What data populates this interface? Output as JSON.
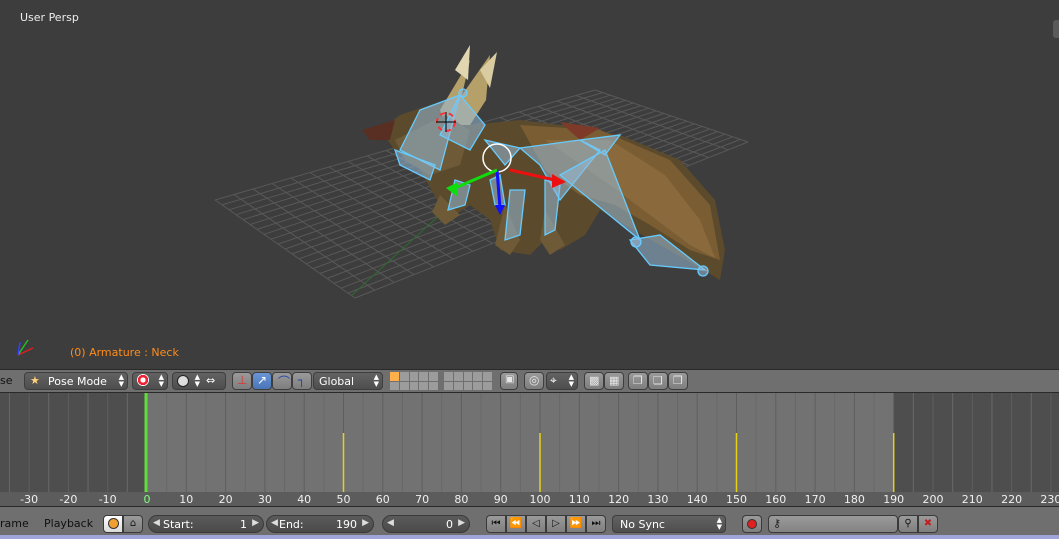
{
  "viewport": {
    "view_name": "User Persp",
    "active_object": "(0) Armature : Neck"
  },
  "view_header": {
    "editor_type_partial": "se",
    "mode": "Pose Mode",
    "transform_orientation": "Global",
    "icons": [
      "pose-mode-icon",
      "viewport-shading-icon",
      "pivot-point-icon",
      "manipulator-toggle-icon",
      "translate-manipulator-icon",
      "rotate-manipulator-icon",
      "scale-manipulator-icon",
      "layers-grid-icon",
      "lock-icon",
      "proportional-edit-icon",
      "snap-icon",
      "render-icon",
      "clapper-icon",
      "copy-pose-icon",
      "paste-pose-icon",
      "paste-flipped-pose-icon"
    ]
  },
  "timeline": {
    "ruler_ticks": [
      "-30",
      "-20",
      "-10",
      "0",
      "10",
      "20",
      "30",
      "40",
      "50",
      "60",
      "70",
      "80",
      "90",
      "100",
      "110",
      "120",
      "130",
      "140",
      "150",
      "160",
      "170",
      "180",
      "190",
      "200",
      "210",
      "220",
      "230"
    ],
    "current_frame_value": 0,
    "keyframes": [
      50,
      100,
      150,
      190
    ],
    "range_start": 0,
    "range_end": 190,
    "colors": {
      "current_frame": "#60dd3c",
      "keyframe": "#e6d11a",
      "active_range": "#727272",
      "outside_range": "#4e4e4e"
    }
  },
  "timeline_header": {
    "frame_menu_partial": "rame",
    "playback_menu": "Playback",
    "start_label": "Start:",
    "start_value": "1",
    "end_label": "End:",
    "end_value": "190",
    "current_frame": "0",
    "sync_mode": "No Sync",
    "icons": [
      "preview-range-icon",
      "lock-icon",
      "jump-start-icon",
      "prev-keyframe-icon",
      "play-reverse-icon",
      "play-icon",
      "next-keyframe-icon",
      "jump-end-icon",
      "record-icon",
      "keying-set-icon",
      "insert-keyframe-icon",
      "delete-keyframe-icon"
    ]
  }
}
